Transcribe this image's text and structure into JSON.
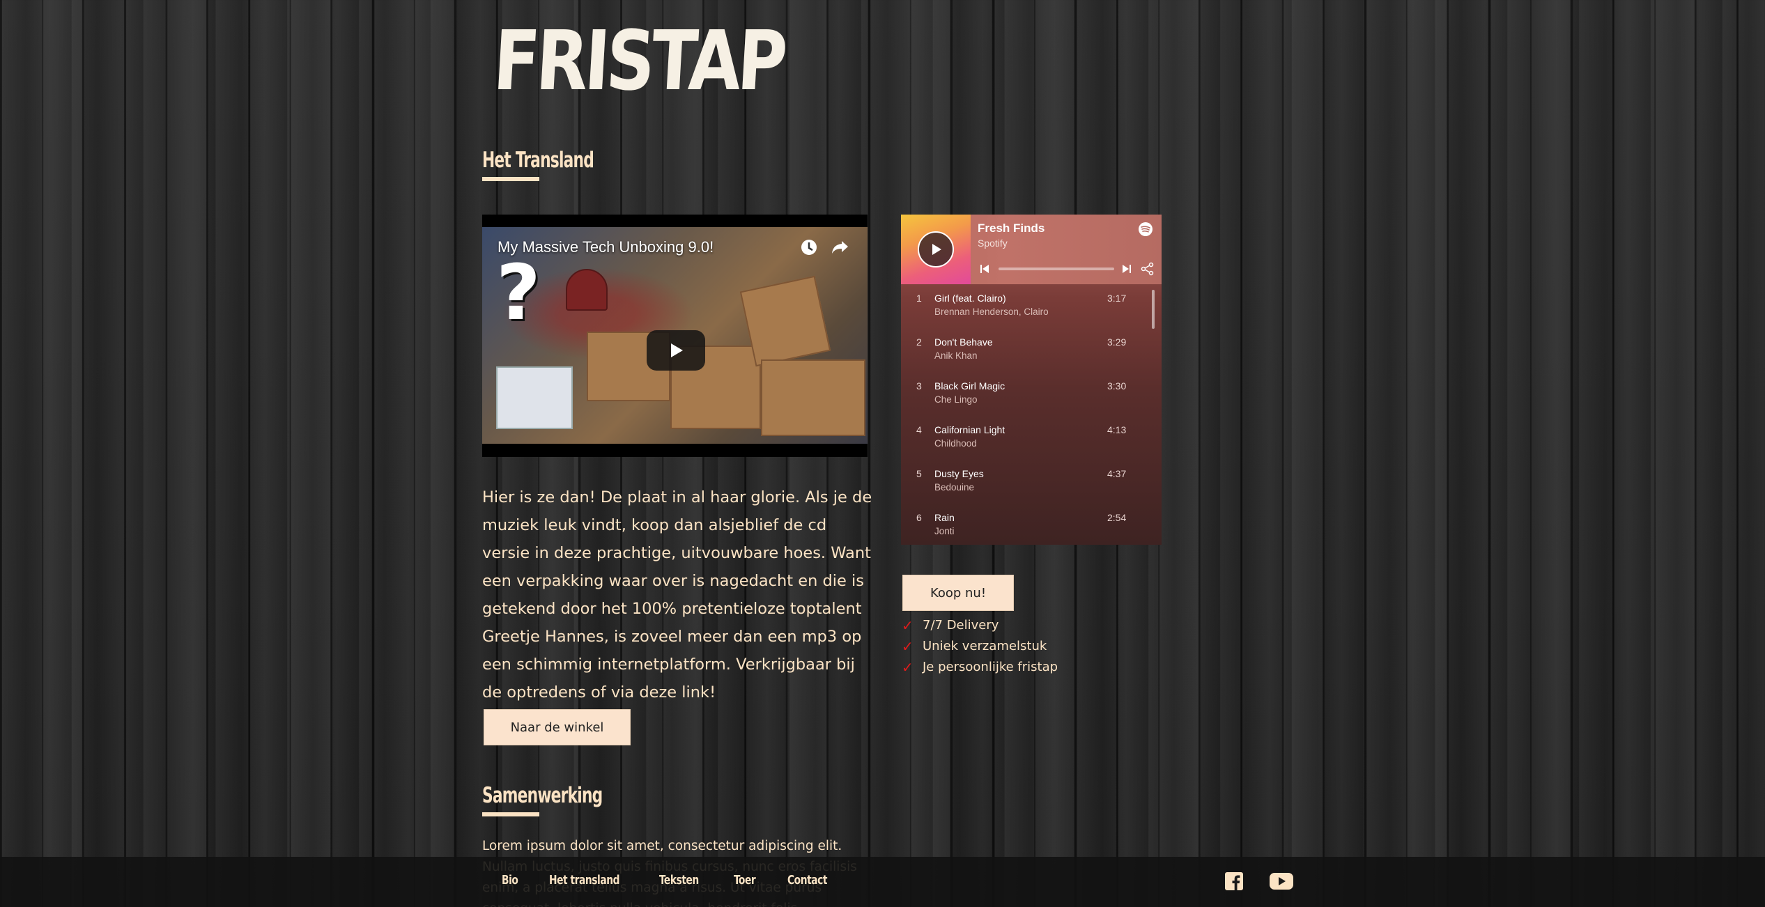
{
  "logo": {
    "text": "FRISTAP"
  },
  "section1": {
    "title": "Het Transland"
  },
  "video": {
    "title": "My Massive Tech Unboxing 9.0!",
    "icons": [
      "clock-icon",
      "share-icon",
      "play-icon"
    ]
  },
  "intro": {
    "text": "Hier is ze dan! De plaat in al haar glorie. Als je de muziek leuk vindt, koop dan alsjeblief de cd versie in deze prachtige, uitvouwbare hoes. Want een verpakking waar over is nagedacht en die is getekend door het 100% pretentieloze toptalent Greetje Hannes, is zoveel meer dan een mp3 op een schimmig internetplatform. Verkrijgbaar bij de optredens of via deze link!"
  },
  "shop_button": {
    "label": "Naar de winkel"
  },
  "spotify": {
    "playlist": "Fresh Finds",
    "provider": "Spotify",
    "tracks": [
      {
        "num": "1",
        "name": "Girl (feat. Clairo)",
        "artist": "Brennan Henderson, Clairo",
        "duration": "3:17"
      },
      {
        "num": "2",
        "name": "Don't Behave",
        "artist": "Anik Khan",
        "duration": "3:29"
      },
      {
        "num": "3",
        "name": "Black Girl Magic",
        "artist": "Che Lingo",
        "duration": "3:30"
      },
      {
        "num": "4",
        "name": "Californian Light",
        "artist": "Childhood",
        "duration": "4:13"
      },
      {
        "num": "5",
        "name": "Dusty Eyes",
        "artist": "Bedouine",
        "duration": "4:37"
      },
      {
        "num": "6",
        "name": "Rain",
        "artist": "Jonti",
        "duration": "2:54"
      }
    ]
  },
  "buy_button": {
    "label": "Koop nu!"
  },
  "features": [
    "7/7 Delivery",
    "Uniek verzamelstuk",
    "Je persoonlijke fristap"
  ],
  "section2": {
    "title": "Samenwerking"
  },
  "lorem": {
    "text": "Lorem ipsum dolor sit amet, consectetur adipiscing elit. Nullam luctus, justo quis finibus cursus, nunc eros facilisis enim, a placerat tellus magna a risus. Ut vitae purus consequat, lobortis nulla vehicula, hendrerit felis."
  },
  "footer": {
    "nav": [
      "Bio",
      "Het transland",
      "Teksten",
      "Toer",
      "Contact"
    ],
    "social": [
      "facebook-icon",
      "youtube-icon"
    ]
  },
  "colors": {
    "accent": "#fbe3c4",
    "button_bg": "#fbe3cd",
    "check": "#e01b1b"
  }
}
